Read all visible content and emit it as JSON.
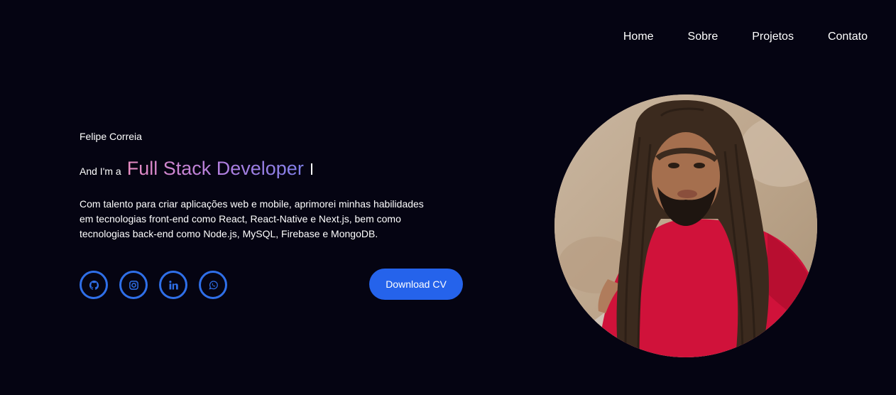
{
  "nav": {
    "items": [
      {
        "label": "Home"
      },
      {
        "label": "Sobre"
      },
      {
        "label": "Projetos"
      },
      {
        "label": "Contato"
      }
    ]
  },
  "hero": {
    "name": "Felipe Correia",
    "intro": "And I'm a",
    "role": "Full Stack Developer",
    "description": "Com talento para criar aplicações web e mobile, aprimorei minhas habilidades em tecnologias front-end como React, React-Native e Next.js, bem como tecnologias back-end como Node.js, MySQL, Firebase e MongoDB.",
    "cv_button": "Download CV"
  },
  "socials": [
    {
      "icon": "github-icon"
    },
    {
      "icon": "instagram-icon"
    },
    {
      "icon": "linkedin-icon"
    },
    {
      "icon": "whatsapp-icon"
    }
  ],
  "colors": {
    "background": "#050412",
    "accent": "#2563eb",
    "role_gradient": [
      "#e78bc1",
      "#b07fe1",
      "#7f7fe8"
    ]
  }
}
